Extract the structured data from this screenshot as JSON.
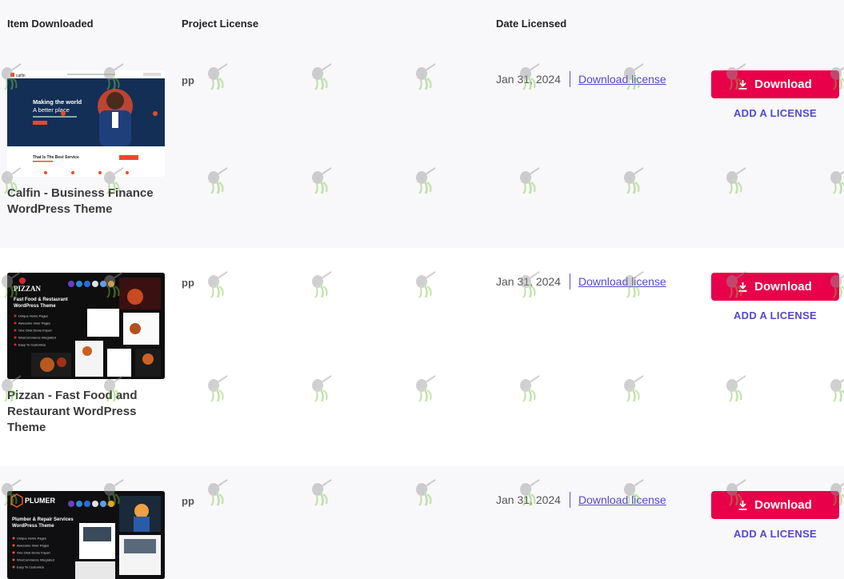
{
  "table": {
    "headers": {
      "item": "Item Downloaded",
      "project": "Project License",
      "date": "Date Licensed"
    },
    "rows": [
      {
        "title": "Calfin - Business Finance WordPress Theme",
        "project": "pp",
        "date": "Jan 31, 2024",
        "download_license": "Download license",
        "download_label": "Download",
        "add_license": "ADD A LICENSE",
        "thumb": {
          "logo": "calfin",
          "headline1": "Making the world",
          "headline2": "A better place",
          "subhead": "That Is The Best Service"
        }
      },
      {
        "title": "Pizzan - Fast Food and Restaurant WordPress Theme",
        "project": "pp",
        "date": "Jan 31, 2024",
        "download_license": "Download license",
        "download_label": "Download",
        "add_license": "ADD A LICENSE",
        "thumb": {
          "logo": "PIZZAN",
          "headline1": "Fast Food & Restaurant",
          "headline2": "WordPress Theme",
          "features": [
            "Unique Home Pages",
            "Awesome Inner Pages",
            "One Click Demo Import",
            "WooCommerce Integrated",
            "Easy To Customize"
          ]
        }
      },
      {
        "title": "",
        "project": "pp",
        "date": "Jan 31, 2024",
        "download_license": "Download license",
        "download_label": "Download",
        "add_license": "ADD A LICENSE",
        "thumb": {
          "logo": "PLUMER",
          "headline1": "Plumber & Repair Services",
          "headline2": "WordPress Theme",
          "features": [
            "Unique Home Pages",
            "Awesome Inner Pages",
            "One Click Demo Import",
            "WooCommerce Integrated",
            "Easy To Customize"
          ]
        }
      }
    ]
  },
  "colors": {
    "accent": "#e8004a",
    "link": "#5548c8",
    "row_alt": "#f8f8fa",
    "row_white": "#ffffff"
  },
  "icons": {
    "download": "download-icon",
    "watermark": "watering-can-icon"
  }
}
